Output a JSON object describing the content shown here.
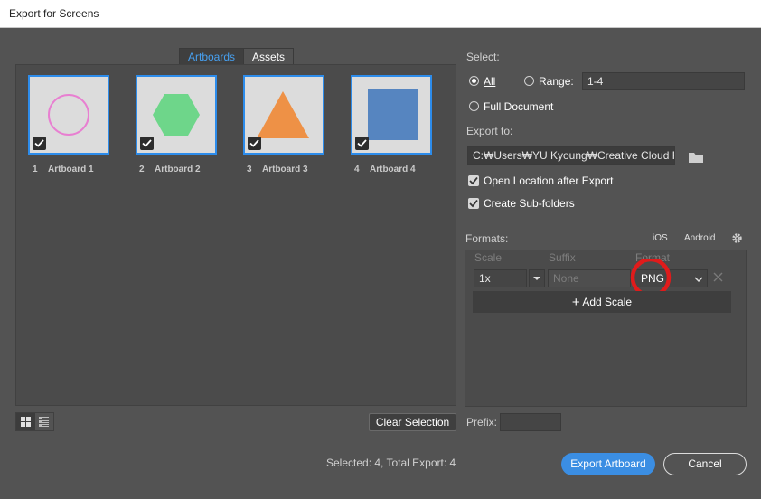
{
  "window": {
    "title": "Export for Screens"
  },
  "tabs": [
    {
      "label": "Artboards"
    },
    {
      "label": "Assets"
    }
  ],
  "artboards": [
    {
      "num": "1",
      "name": "Artboard 1",
      "shape": "circle",
      "color": "#e87fd1"
    },
    {
      "num": "2",
      "name": "Artboard 2",
      "shape": "hexagon",
      "color": "#6ed68a"
    },
    {
      "num": "3",
      "name": "Artboard 3",
      "shape": "triangle",
      "color": "#ee9146"
    },
    {
      "num": "4",
      "name": "Artboard 4",
      "shape": "square",
      "color": "#5685c0"
    }
  ],
  "select": {
    "label": "Select:",
    "all_label": "All",
    "range_label": "Range:",
    "range_value": "1-4",
    "full_document_label": "Full Document"
  },
  "export_to": {
    "label": "Export to:",
    "path": "C:₩Users₩YU Kyoung₩Creative Cloud F",
    "open_location_label": "Open Location after Export",
    "create_subfolders_label": "Create Sub-folders"
  },
  "formats": {
    "label": "Formats:",
    "ios_label": "iOS",
    "android_label": "Android",
    "col_scale": "Scale",
    "col_suffix": "Suffix",
    "col_format": "Format",
    "scale_value": "1x",
    "suffix_placeholder": "None",
    "format_value": "PNG",
    "add_scale_label": "Add Scale",
    "highlight_color": "#e01b1b"
  },
  "prefix": {
    "label": "Prefix:",
    "value": ""
  },
  "footer": {
    "clear_selection_label": "Clear Selection",
    "status": "Selected: 4, Total Export: 4",
    "export_label": "Export Artboard",
    "cancel_label": "Cancel"
  },
  "accent_color": "#3b8ee3"
}
